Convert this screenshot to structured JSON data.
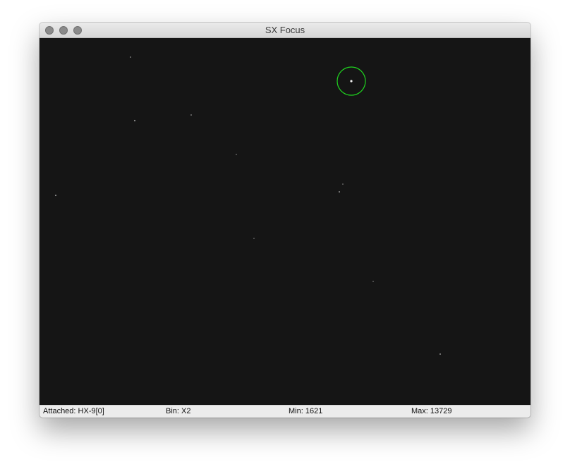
{
  "window": {
    "title": "SX Focus"
  },
  "image": {
    "background_color": "#151515",
    "star_color": "#d8d8d8",
    "focus_ring_color": "#1fd61f"
  },
  "status": {
    "attached": "Attached: HX-9[0]",
    "bin": "Bin: X2",
    "min": "Min: 1621",
    "max": "Max: 13729"
  }
}
